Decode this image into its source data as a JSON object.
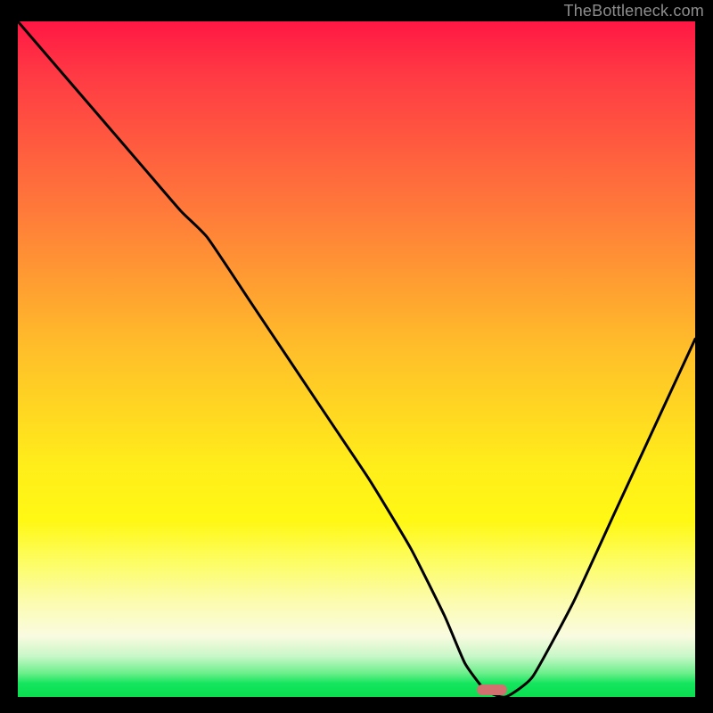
{
  "watermark": "TheBottleneck.com",
  "chart_data": {
    "type": "line",
    "title": "",
    "xlabel": "",
    "ylabel": "",
    "xlim": [
      0,
      100
    ],
    "ylim": [
      0,
      100
    ],
    "x": [
      0,
      6,
      12,
      18,
      24,
      28,
      34,
      40,
      46,
      52,
      58,
      63,
      66,
      69,
      72,
      76,
      82,
      88,
      94,
      100
    ],
    "y": [
      100,
      93,
      86,
      79,
      72,
      68,
      59,
      50,
      41,
      32,
      22,
      12,
      5,
      1,
      0,
      3,
      14,
      27,
      40,
      53
    ],
    "marker": {
      "x": 70,
      "y": 1
    },
    "colors": {
      "curve": "#000000",
      "marker": "#d27070",
      "gradient_top": "#ff1744",
      "gradient_bottom": "#0ade4f"
    }
  }
}
